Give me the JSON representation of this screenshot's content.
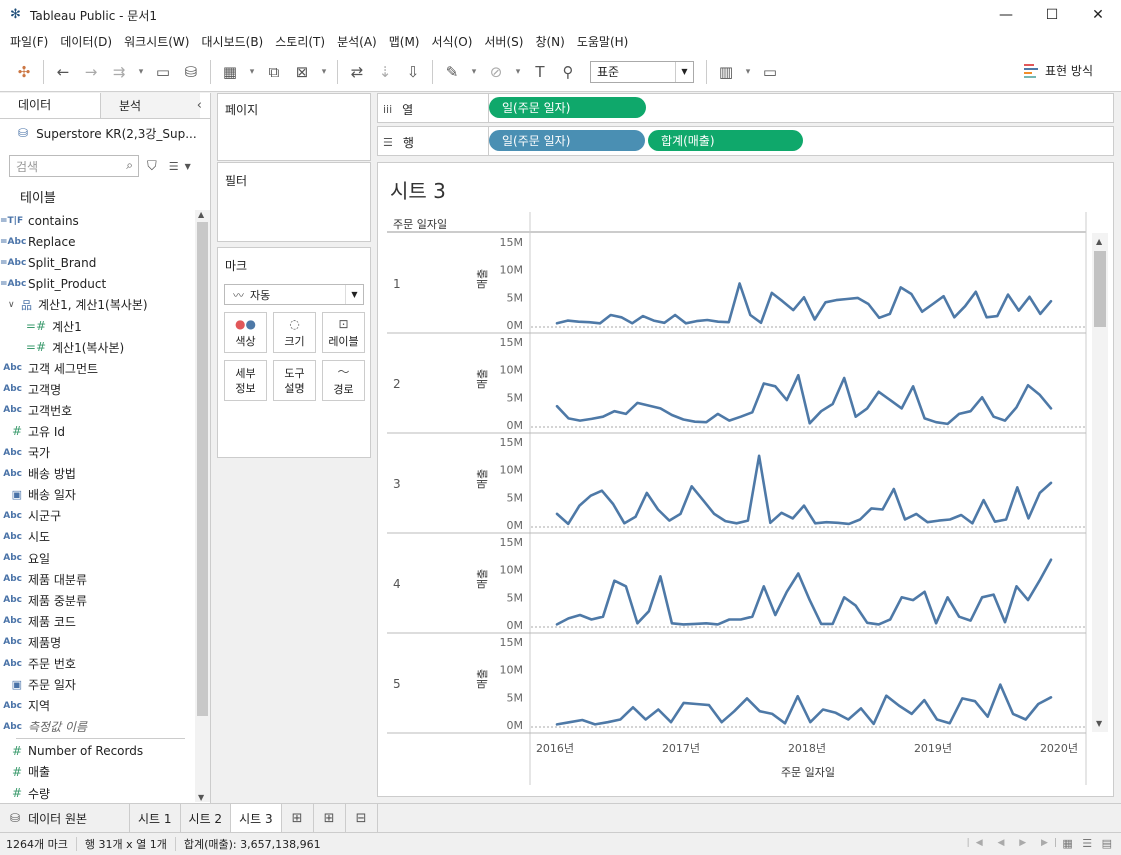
{
  "window": {
    "title": "Tableau Public - 문서1",
    "min": "—",
    "max": "☐",
    "close": "✕"
  },
  "menu": [
    "파일(F)",
    "데이터(D)",
    "워크시트(W)",
    "대시보드(B)",
    "스토리(T)",
    "분석(A)",
    "맵(M)",
    "서식(O)",
    "서버(S)",
    "창(N)",
    "도움말(H)"
  ],
  "toolbar": {
    "fit_label": "표준",
    "show_me_label": "표현 방식"
  },
  "left": {
    "tab_data": "데이터",
    "tab_analysis": "분석",
    "datasource": "Superstore KR(2,3강_Sup...",
    "search_placeholder": "검색",
    "tables_header": "테이블",
    "fields": [
      {
        "icon": "=T|F",
        "label": "contains"
      },
      {
        "icon": "=Abc",
        "label": "Replace"
      },
      {
        "icon": "=Abc",
        "label": "Split_Brand"
      },
      {
        "icon": "=Abc",
        "label": "Split_Product"
      },
      {
        "icon": "品",
        "label": "계산1, 계산1(복사본)"
      },
      {
        "icon": "=#",
        "label": "계산1"
      },
      {
        "icon": "=#",
        "label": "계산1(복사본)"
      },
      {
        "icon": "Abc",
        "label": "고객 세그먼트"
      },
      {
        "icon": "Abc",
        "label": "고객명"
      },
      {
        "icon": "Abc",
        "label": "고객번호"
      },
      {
        "icon": "#",
        "label": "고유 Id"
      },
      {
        "icon": "Abc",
        "label": "국가"
      },
      {
        "icon": "Abc",
        "label": "배송 방법"
      },
      {
        "icon": "▣",
        "label": "배송 일자"
      },
      {
        "icon": "Abc",
        "label": "시군구"
      },
      {
        "icon": "Abc",
        "label": "시도"
      },
      {
        "icon": "Abc",
        "label": "요일"
      },
      {
        "icon": "Abc",
        "label": "제품 대분류"
      },
      {
        "icon": "Abc",
        "label": "제품 중분류"
      },
      {
        "icon": "Abc",
        "label": "제품 코드"
      },
      {
        "icon": "Abc",
        "label": "제품명"
      },
      {
        "icon": "Abc",
        "label": "주문 번호"
      },
      {
        "icon": "▣",
        "label": "주문 일자"
      },
      {
        "icon": "Abc",
        "label": "지역"
      },
      {
        "icon": "Abc",
        "label": "측정값 이름"
      }
    ],
    "measures": [
      {
        "icon": "#",
        "label": "Number of Records"
      },
      {
        "icon": "#",
        "label": "매출"
      },
      {
        "icon": "#",
        "label": "수량"
      }
    ]
  },
  "cards": {
    "pages": "페이지",
    "filters": "필터",
    "marks": "마크",
    "mark_type": "자동",
    "buttons": [
      {
        "name": "color",
        "label": "색상"
      },
      {
        "name": "size",
        "label": "크기"
      },
      {
        "name": "label",
        "label": "레이블"
      },
      {
        "name": "detail",
        "label": "세부\n정보"
      },
      {
        "name": "tooltip",
        "label": "도구\n설명"
      },
      {
        "name": "path",
        "label": "경로"
      }
    ]
  },
  "shelves": {
    "columns_label": "열",
    "rows_label": "행",
    "columns_pills": [
      "일(주문 일자)"
    ],
    "rows_pills": [
      "일(주문 일자)",
      "합계(매출)"
    ]
  },
  "view": {
    "sheet_title": "시트 3",
    "row_header": "주문 일자일",
    "y_axis_label": "매출",
    "x_axis_title": "주문 일자일"
  },
  "chart_data": {
    "type": "line",
    "x_ticks": [
      "2016년",
      "2017년",
      "2018년",
      "2019년",
      "2020년"
    ],
    "y_ticks": [
      "15M",
      "10M",
      "5M",
      "0M"
    ],
    "ylim": [
      0,
      15000000
    ],
    "panes": [
      {
        "row": "1",
        "values": [
          0.3,
          0.8,
          0.6,
          0.5,
          0.3,
          1.8,
          1.4,
          0.3,
          1.6,
          0.8,
          0.4,
          1.8,
          0.3,
          0.7,
          0.9,
          0.6,
          0.5,
          7.5,
          1.8,
          0.4,
          5.8,
          4.3,
          2.7,
          5.0,
          1.0,
          4.1,
          4.5,
          4.7,
          4.9,
          3.8,
          1.3,
          2.0,
          6.8,
          5.6,
          2.4,
          3.8,
          5.2,
          1.4,
          3.4,
          6.0,
          1.4,
          1.6,
          5.5,
          2.6,
          5.1,
          2.0,
          4.3
        ]
      },
      {
        "row": "2",
        "values": [
          3.4,
          1.2,
          0.8,
          1.1,
          1.5,
          2.5,
          2.0,
          4.0,
          3.5,
          3.0,
          1.8,
          1.0,
          0.6,
          0.5,
          2.0,
          0.8,
          1.5,
          2.3,
          7.5,
          7.0,
          4.5,
          9.0,
          0.3,
          2.5,
          3.8,
          8.5,
          1.5,
          3.0,
          6.0,
          4.5,
          3.0,
          7.0,
          1.2,
          0.5,
          0.2,
          2.0,
          2.5,
          5.0,
          1.5,
          0.8,
          3.2,
          7.2,
          5.5,
          3.0
        ]
      },
      {
        "row": "3",
        "values": [
          2.0,
          0.2,
          3.5,
          5.3,
          6.2,
          3.8,
          0.3,
          1.5,
          5.8,
          2.8,
          0.8,
          2.0,
          7.0,
          4.5,
          2.0,
          0.7,
          0.3,
          0.8,
          12.5,
          0.4,
          2.2,
          1.2,
          3.5,
          0.3,
          0.5,
          0.4,
          0.2,
          1.0,
          3.0,
          2.8,
          6.5,
          1.0,
          2.0,
          0.5,
          0.8,
          1.0,
          1.8,
          0.3,
          4.5,
          0.6,
          1.0,
          6.8,
          1.2,
          5.8,
          7.6
        ]
      },
      {
        "row": "4",
        "values": [
          0.1,
          1.2,
          1.8,
          1.0,
          1.5,
          8.0,
          7.0,
          0.3,
          2.5,
          8.8,
          0.3,
          0.1,
          0.2,
          0.3,
          0.1,
          1.0,
          1.0,
          1.5,
          7.0,
          1.8,
          6.0,
          9.3,
          4.5,
          0.2,
          0.2,
          5.0,
          3.5,
          0.4,
          0.1,
          1.0,
          5.0,
          4.5,
          6.0,
          0.3,
          5.0,
          1.5,
          0.8,
          5.0,
          5.5,
          0.5,
          7.0,
          4.5,
          8.0,
          11.8
        ]
      },
      {
        "row": "5",
        "values": [
          0.1,
          0.5,
          0.9,
          0.1,
          0.5,
          1.0,
          3.2,
          1.0,
          2.8,
          0.5,
          4.0,
          3.8,
          3.6,
          0.5,
          2.5,
          4.8,
          2.5,
          2.0,
          0.3,
          5.2,
          0.5,
          2.8,
          2.2,
          1.0,
          3.0,
          0.2,
          5.3,
          3.5,
          2.0,
          4.5,
          1.0,
          0.3,
          4.8,
          4.3,
          1.5,
          7.3,
          2.0,
          1.0,
          3.8,
          5.0
        ]
      }
    ]
  },
  "sheet_tabs": {
    "source": "데이터 원본",
    "tabs": [
      "시트 1",
      "시트 2",
      "시트 3"
    ],
    "active": 2
  },
  "status": {
    "marks": "1264개 마크",
    "rows_cols": "행 31개 x 열 1개",
    "sum": "합계(매출): 3,657,138,961"
  },
  "colors": {
    "line": "#4e79a7",
    "pill_green": "#0fa86b",
    "pill_blue": "#4a8fb3"
  }
}
